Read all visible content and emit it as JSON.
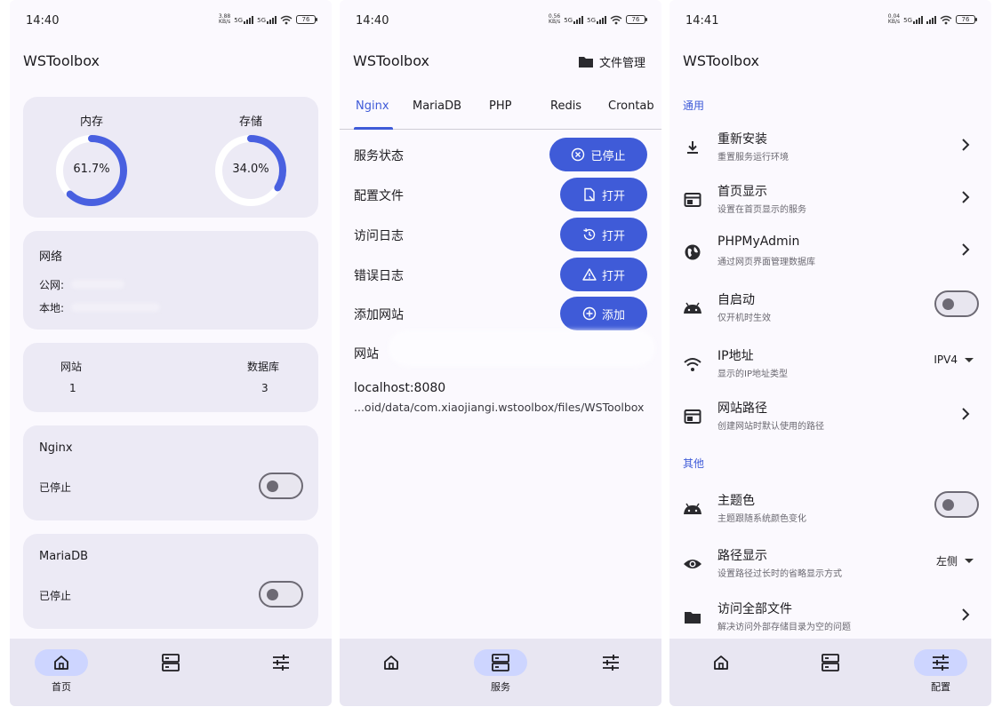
{
  "app_title": "WSToolbox",
  "screens": {
    "home": {
      "status": {
        "time": "14:40",
        "speed": "3.88 KB/s",
        "sig1": "5G",
        "sig2": "5G",
        "battery": "76"
      },
      "memory": {
        "label": "内存",
        "value": "61.7%",
        "fraction": 0.617
      },
      "storage": {
        "label": "存储",
        "value": "34.0%",
        "fraction": 0.34
      },
      "network": {
        "title": "网络",
        "public_label": "公网:",
        "local_label": "本地:"
      },
      "counts": {
        "sites_label": "网站",
        "sites_value": "1",
        "db_label": "数据库",
        "db_value": "3"
      },
      "nginx": {
        "name": "Nginx",
        "status": "已停止"
      },
      "mariadb": {
        "name": "MariaDB",
        "status": "已停止"
      }
    },
    "service": {
      "status": {
        "time": "14:40",
        "speed": "0.56 KB/s",
        "sig1": "5G",
        "sig2": "5G",
        "battery": "76"
      },
      "file_manager": "文件管理",
      "tabs": [
        "Nginx",
        "MariaDB",
        "PHP",
        "Redis",
        "Crontab"
      ],
      "rows": [
        {
          "label": "服务状态",
          "button": "已停止"
        },
        {
          "label": "配置文件",
          "button": "打开"
        },
        {
          "label": "访问日志",
          "button": "打开"
        },
        {
          "label": "错误日志",
          "button": "打开"
        },
        {
          "label": "添加网站",
          "button": "添加"
        }
      ],
      "site_label": "网站",
      "site_host": "localhost:8080",
      "site_path": "...oid/data/com.xiaojiangi.wstoolbox/files/WSToolbox"
    },
    "config": {
      "status": {
        "time": "14:41",
        "speed": "0.04 KB/s",
        "sig1": "5G",
        "sig2": "",
        "battery": "76"
      },
      "section_general": "通用",
      "section_other": "其他",
      "items": [
        {
          "title": "重新安装",
          "sub": "重置服务运行环境",
          "icon": "download-icon"
        },
        {
          "title": "首页显示",
          "sub": "设置在首页显示的服务",
          "icon": "window-icon"
        },
        {
          "title": "PHPMyAdmin",
          "sub": "通过网页界面管理数据库",
          "icon": "globe-icon"
        },
        {
          "title": "自启动",
          "sub": "仅开机时生效",
          "icon": "android-icon"
        },
        {
          "title": "IP地址",
          "sub": "显示的IP地址类型",
          "icon": "wifi-icon",
          "value": "IPV4"
        },
        {
          "title": "网站路径",
          "sub": "创建网站时默认使用的路径",
          "icon": "window-icon"
        },
        {
          "title": "主题色",
          "sub": "主题跟随系统颜色变化",
          "icon": "android-icon"
        },
        {
          "title": "路径显示",
          "sub": "设置路径过长时的省略显示方式",
          "icon": "eye-icon",
          "value": "左侧"
        },
        {
          "title": "访问全部文件",
          "sub": "解决访问外部存储目录为空的问题",
          "icon": "folder-icon"
        }
      ]
    }
  },
  "nav": {
    "home": "首页",
    "service": "服务",
    "config": "配置"
  },
  "colors": {
    "accent": "#3f5bd8",
    "card": "#eceaf5",
    "nav_active": "#cdd5ff"
  }
}
